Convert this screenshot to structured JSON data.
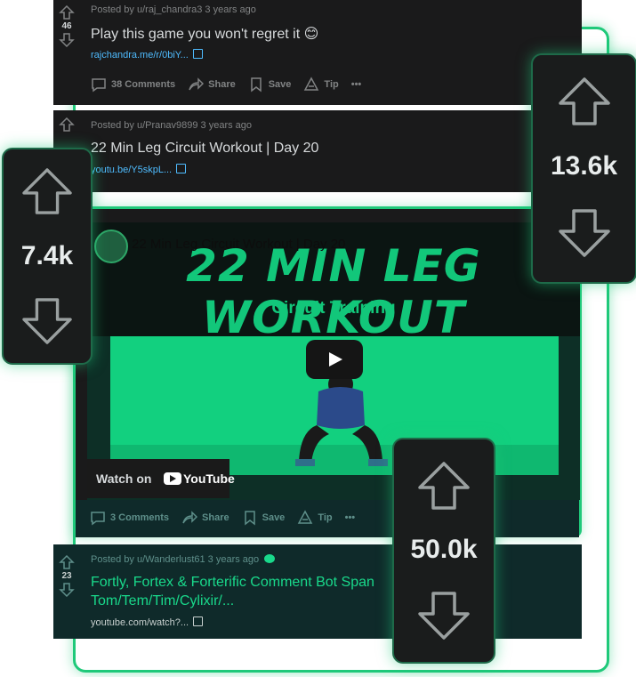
{
  "posts": [
    {
      "author_line": "Posted by u/raj_chandra3 3 years ago",
      "score": "46",
      "title": "Play this game you won't regret it 😊",
      "link": "rajchandra.me/r/0biY...",
      "comments": "38 Comments",
      "share": "Share",
      "save": "Save",
      "tip": "Tip"
    },
    {
      "author_line": "Posted by u/Pranav9899 3 years ago",
      "title": "22 Min Leg Circuit Workout | Day 20",
      "link": "youtu.be/Y5skpL..."
    },
    {
      "comments": "3 Comments",
      "share": "Share",
      "save": "Save",
      "tip": "Tip"
    },
    {
      "author_line": "Posted by u/Wanderlust61 3 years ago",
      "score": "23",
      "title_line1": "Fortly, Fortex & Forterific Comment Bot Span",
      "title_line2": "Tom/Tem/Tim/Cylixir/...",
      "link": "youtube.com/watch?..."
    }
  ],
  "video": {
    "overlay_title": "22 Min Leg Circuit Workout | Day 20",
    "headline": "22 MIN LEG WORKOUT",
    "subtitle": "Circuit Training",
    "watch_on": "Watch on",
    "youtube": "YouTube"
  },
  "vote_boxes": {
    "left": "7.4k",
    "right": "13.6k",
    "bottom": "50.0k"
  },
  "colors": {
    "accent": "#1fc97a",
    "link": "#4fbcff",
    "card": "#1a1a1b"
  }
}
